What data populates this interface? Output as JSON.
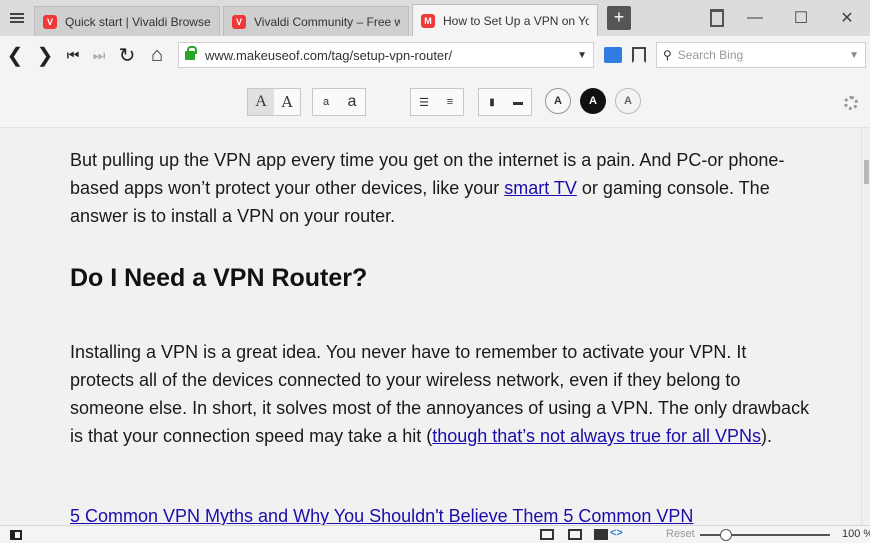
{
  "tabs": [
    {
      "title": "Quick start | Vivaldi Browser",
      "active": false
    },
    {
      "title": "Vivaldi Community – Free we",
      "active": false
    },
    {
      "title": "How to Set Up a VPN on You",
      "active": true
    }
  ],
  "window_controls": {
    "minimize": "—",
    "maximize": "☐",
    "close": "✕"
  },
  "address": {
    "url": "www.makeuseof.com/tag/setup-vpn-router/"
  },
  "search": {
    "placeholder": "Search Bing"
  },
  "reader": {
    "font_buttons": [
      "A",
      "A"
    ],
    "size_buttons": [
      "a",
      "a"
    ],
    "theme_buttons": [
      "A",
      "A",
      "A"
    ]
  },
  "article": {
    "para1_text1": "But pulling up the VPN app every time you get on the internet is a pain. And PC-or phone-based apps won’t protect your other devices, like your ",
    "para1_link": "smart TV",
    "para1_text2": " or gaming console. The answer is to install a VPN on your router.",
    "heading": "Do I Need a VPN Router?",
    "para2_text": "Installing a VPN is a great idea. You never have to remember to activate your VPN. It protects all of the devices connected to your wireless network, even if they belong to someone else. In short, it solves most of the annoyances of using a VPN. The only drawback is that your connection speed may take a hit (",
    "para2_link": "though that’s not always true for all VPNs",
    "para2_end": ").",
    "partial_link": "5 Common VPN Myths and Why You Shouldn't Believe Them 5 Common VPN"
  },
  "status": {
    "reset_label": "Reset",
    "zoom": "100 %",
    "zoom_level": 1.0
  },
  "colors": {
    "link": "#1a0dab",
    "accent": "#2f7de1",
    "tab_favicon": "#ef3939"
  }
}
